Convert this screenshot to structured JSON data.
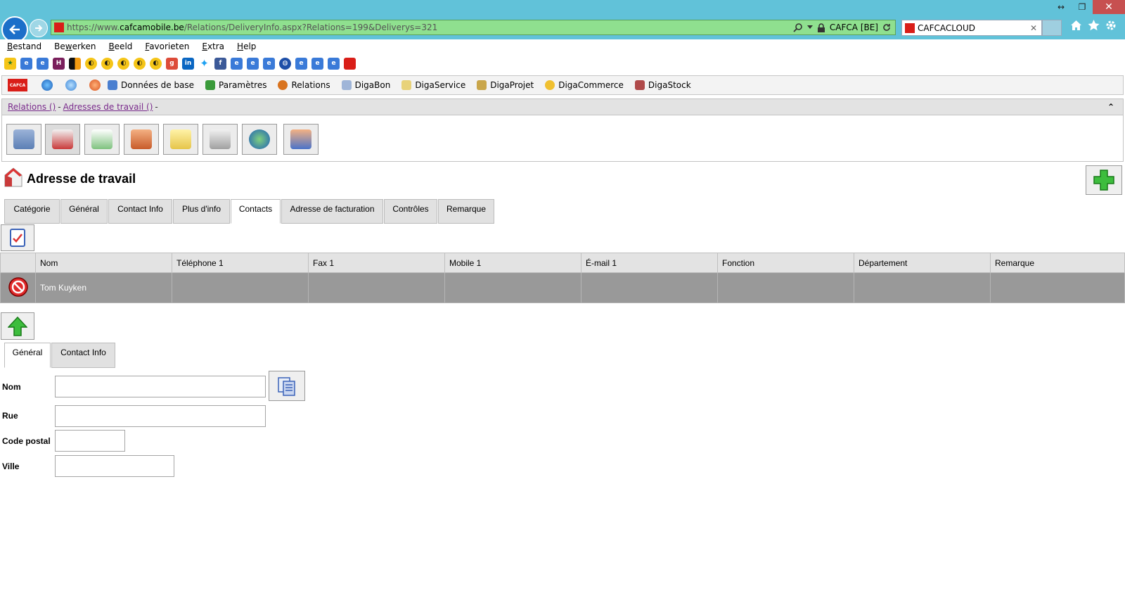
{
  "browser": {
    "window_controls": [
      "↔",
      "❐",
      "✕"
    ],
    "url_prefix": "https://www.",
    "url_host": "cafcamobile.be",
    "url_path": "/Relations/DeliveryInfo.aspx?Relations=199&Deliverys=321",
    "site_identity": "CAFCA [BE]",
    "tab_title": "CAFCACLOUD",
    "tab_close": "✕",
    "icons": [
      "home-icon",
      "star-icon",
      "gear-icon"
    ]
  },
  "menu": [
    "Bestand",
    "Bewerken",
    "Beeld",
    "Favorieten",
    "Extra",
    "Help"
  ],
  "menu_underline": [
    "B",
    "w",
    "B",
    "F",
    "E",
    "H"
  ],
  "toolbar": {
    "logo_text": "CAFCA",
    "items": [
      "Données de base",
      "Paramètres",
      "Relations",
      "DigaBon",
      "DigaService",
      "DigaProjet",
      "DigaCommerce",
      "DigaStock"
    ]
  },
  "breadcrumb": {
    "item1": "Relations ()",
    "sep1": "-",
    "item2": "Adresses de travail ()",
    "sep2": "-",
    "collapse": "⌃"
  },
  "page": {
    "title": "Adresse de travail"
  },
  "tabs": [
    "Catégorie",
    "Général",
    "Contact Info",
    "Plus d'info",
    "Contacts",
    "Adresse de facturation",
    "Contrôles",
    "Remarque"
  ],
  "active_tab": "Contacts",
  "grid": {
    "columns": [
      "Nom",
      "Téléphone 1",
      "Fax 1",
      "Mobile 1",
      "É-mail 1",
      "Fonction",
      "Département",
      "Remarque"
    ],
    "rows": [
      {
        "nom": "Tom Kuyken",
        "tel": "",
        "fax": "",
        "mobile": "",
        "email": "",
        "fonction": "",
        "departement": "",
        "remarque": ""
      }
    ]
  },
  "subtabs": [
    "Général",
    "Contact Info"
  ],
  "form": {
    "nom_label": "Nom",
    "rue_label": "Rue",
    "cp_label": "Code postal",
    "ville_label": "Ville",
    "nom_value": "",
    "rue_value": "",
    "cp_value": "",
    "ville_value": ""
  },
  "colors": {
    "titlebar": "#61c2d9",
    "address_bar": "#8fe08f",
    "grid_row": "#999999",
    "breadcrumb_link": "#7a2b8c",
    "brand_red": "#d91e18"
  }
}
